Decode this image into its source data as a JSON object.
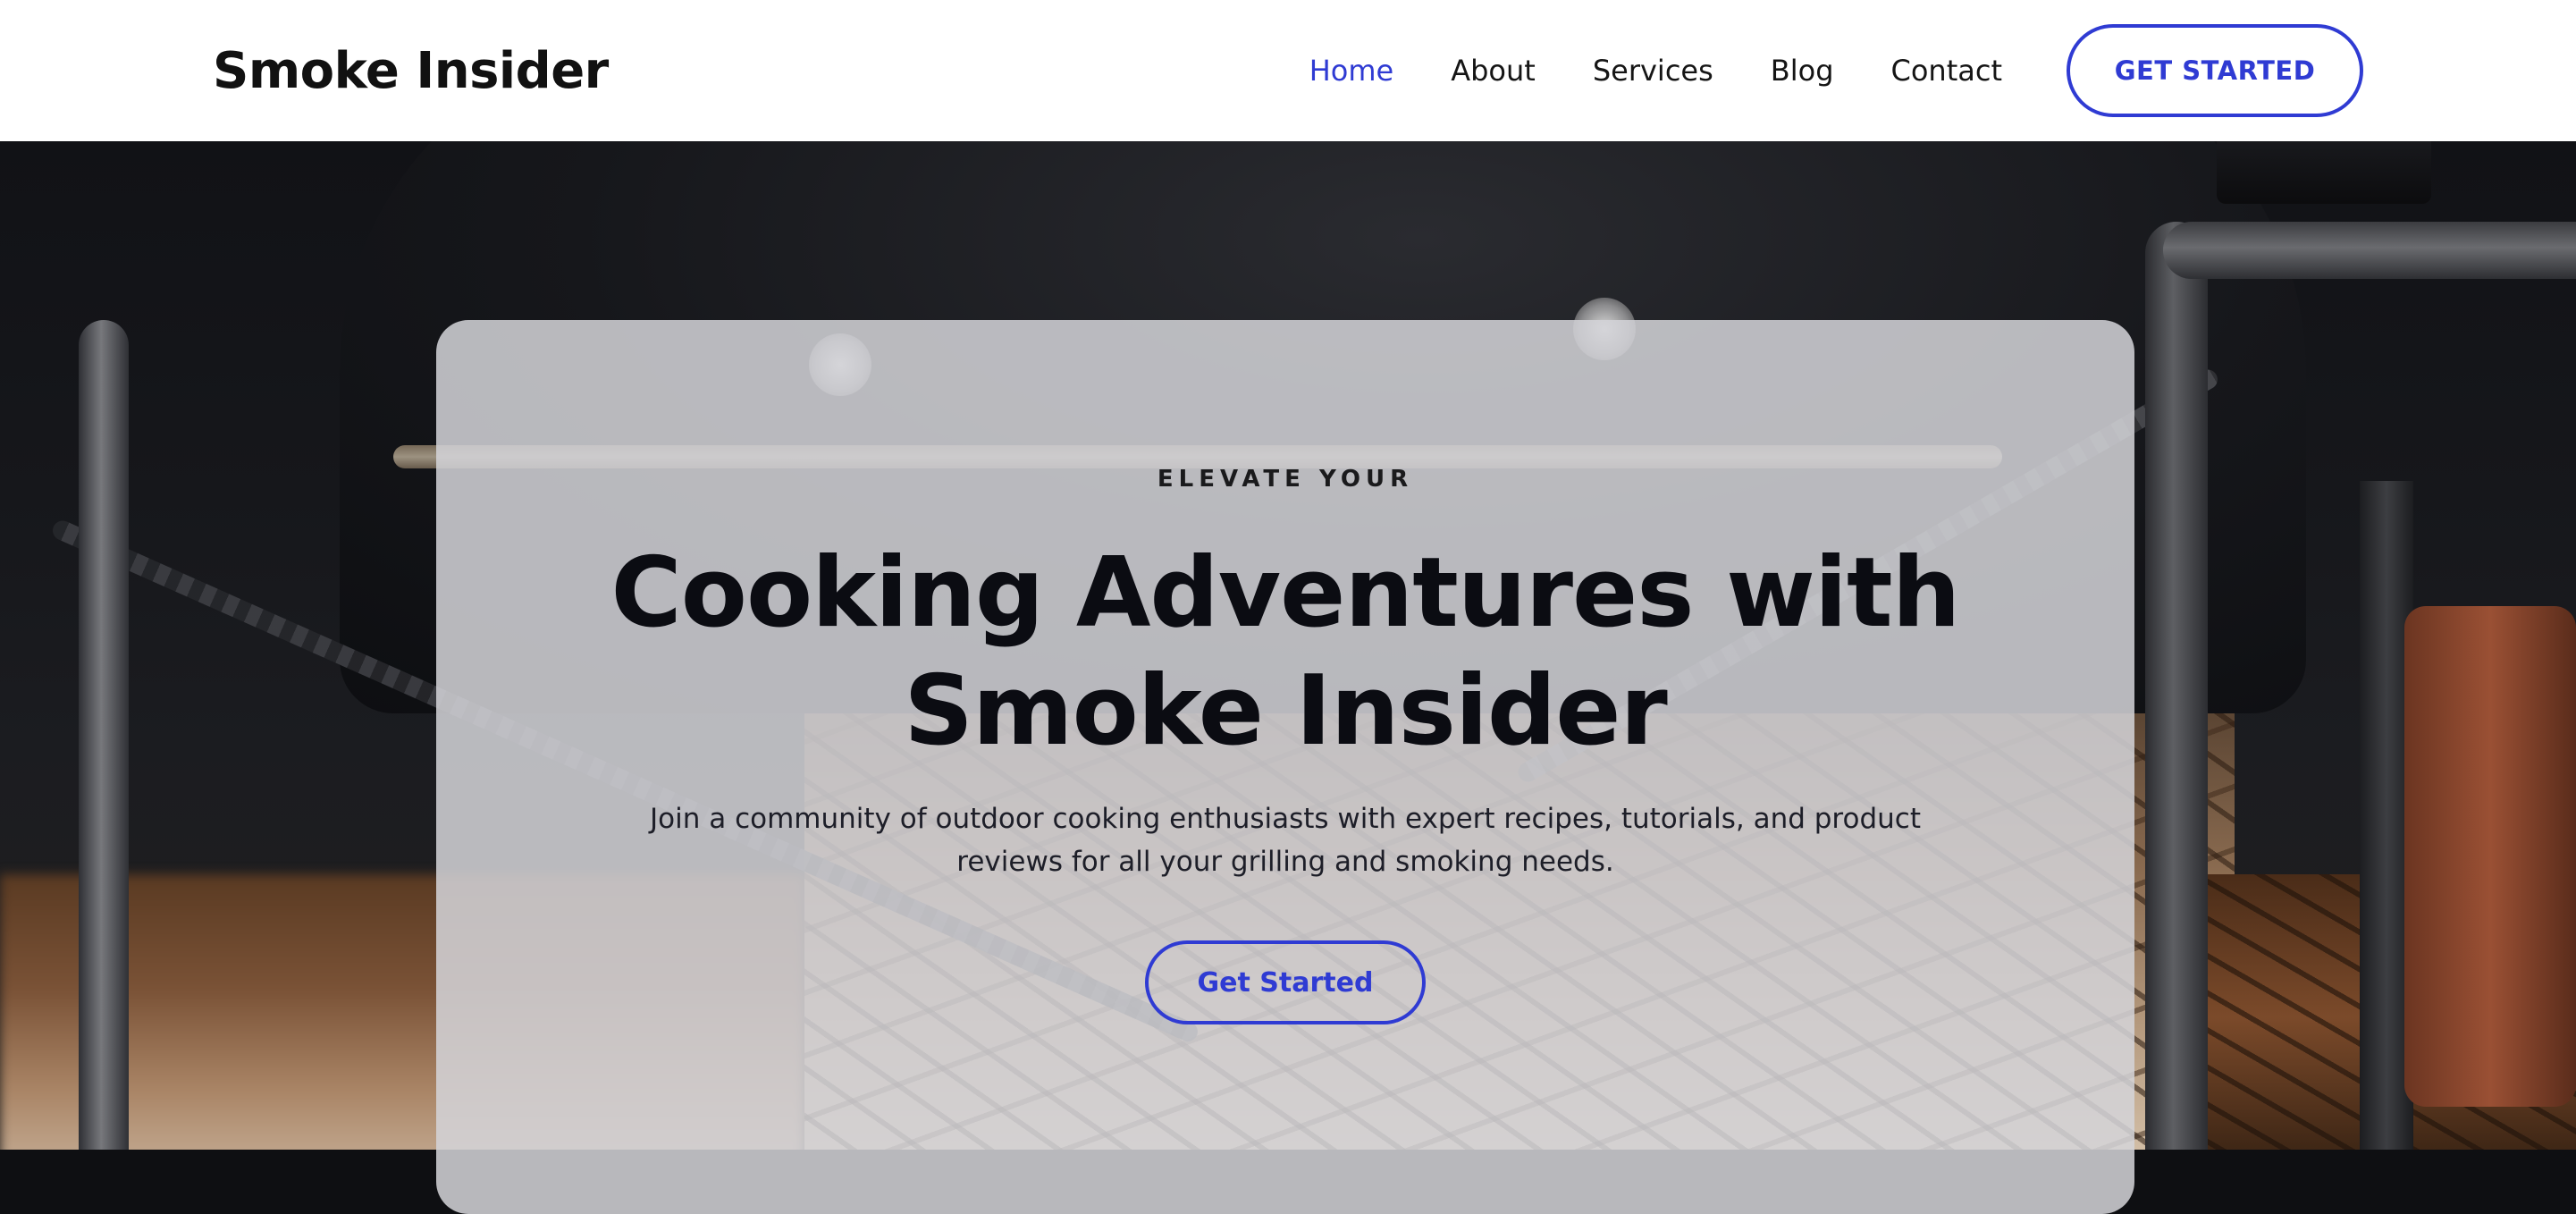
{
  "header": {
    "logo": "Smoke Insider",
    "nav": [
      {
        "label": "Home",
        "active": true
      },
      {
        "label": "About",
        "active": false
      },
      {
        "label": "Services",
        "active": false
      },
      {
        "label": "Blog",
        "active": false
      },
      {
        "label": "Contact",
        "active": false
      }
    ],
    "cta_label": "GET STARTED"
  },
  "hero": {
    "eyebrow": "ELEVATE YOUR",
    "headline_line1": "Cooking Adventures with",
    "headline_line2": "Smoke Insider",
    "subtext": "Join a community of outdoor cooking enthusiasts with expert recipes, tutorials, and product reviews for all your grilling and smoking needs.",
    "cta_label": "Get Started"
  },
  "colors": {
    "accent": "#2f3bd3",
    "header_background": "#ffffff",
    "card_background": "rgba(212,212,216,0.86)",
    "text_dark": "#0b0c12"
  }
}
